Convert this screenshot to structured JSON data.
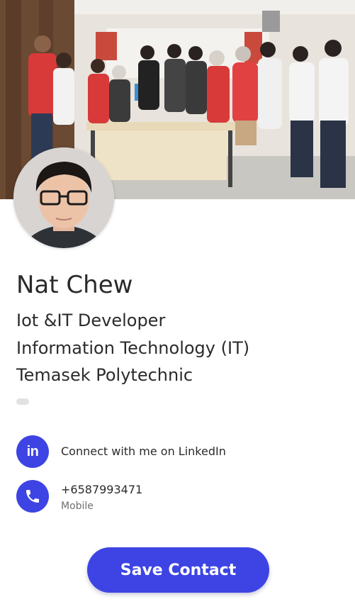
{
  "profile": {
    "name": "Nat Chew",
    "title": "Iot &IT Developer",
    "department": "Information Technology (IT)",
    "organization": "Temasek Polytechnic"
  },
  "contacts": {
    "linkedin": {
      "icon": "linkedin-icon",
      "icon_text": "in",
      "label": "Connect with me on LinkedIn"
    },
    "phone": {
      "icon": "phone-icon",
      "number": "+6587993471",
      "type": "Mobile"
    }
  },
  "actions": {
    "save_label": "Save Contact"
  },
  "colors": {
    "accent": "#3d44e3",
    "text": "#2b2b2b",
    "muted": "#6f6f6f"
  }
}
